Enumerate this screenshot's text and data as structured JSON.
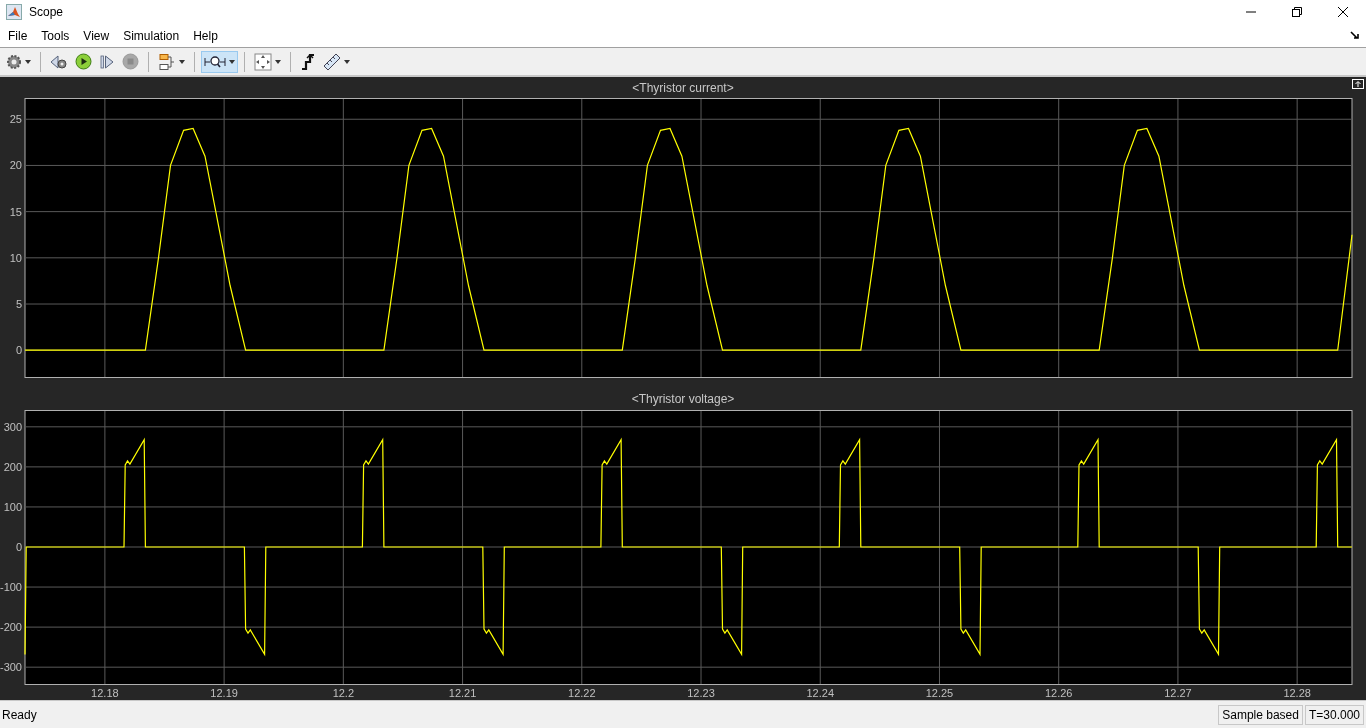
{
  "window": {
    "title": "Scope"
  },
  "menu": [
    "File",
    "Tools",
    "View",
    "Simulation",
    "Help"
  ],
  "toolbar": [
    {
      "kind": "gear",
      "dropdown": true,
      "selected": false
    },
    {
      "kind": "separator"
    },
    {
      "kind": "step-back",
      "dropdown": false,
      "selected": false
    },
    {
      "kind": "run",
      "dropdown": false,
      "selected": false
    },
    {
      "kind": "step-forward",
      "dropdown": false,
      "selected": false
    },
    {
      "kind": "stop",
      "dropdown": false,
      "selected": false
    },
    {
      "kind": "separator"
    },
    {
      "kind": "highlight",
      "dropdown": true,
      "selected": false
    },
    {
      "kind": "separator"
    },
    {
      "kind": "zoom",
      "dropdown": true,
      "selected": true
    },
    {
      "kind": "separator"
    },
    {
      "kind": "fit",
      "dropdown": true,
      "selected": false
    },
    {
      "kind": "separator"
    },
    {
      "kind": "triggers",
      "dropdown": false,
      "selected": false
    },
    {
      "kind": "measure",
      "dropdown": true,
      "selected": false
    }
  ],
  "plots": [
    {
      "chart_data": {
        "type": "line",
        "title": "<Thyristor current>",
        "grid": true,
        "xlim": [
          12.1733,
          12.2846
        ],
        "ylim": [
          -2.9,
          27.3
        ],
        "yticks": [
          0,
          5,
          10,
          15,
          20,
          25
        ],
        "x": [
          12.1733,
          12.1834,
          12.1845,
          12.1855,
          12.1866,
          12.1874,
          12.1884,
          12.1893,
          12.1905,
          12.1918,
          12.2034,
          12.2045,
          12.2055,
          12.2066,
          12.2074,
          12.2084,
          12.2093,
          12.2105,
          12.2118,
          12.2234,
          12.2245,
          12.2255,
          12.2266,
          12.2274,
          12.2284,
          12.2293,
          12.2305,
          12.2318,
          12.2434,
          12.2445,
          12.2455,
          12.2466,
          12.2474,
          12.2484,
          12.2493,
          12.2505,
          12.2518,
          12.2634,
          12.2645,
          12.2655,
          12.2666,
          12.2674,
          12.2684,
          12.2693,
          12.2705,
          12.2718,
          12.2834,
          12.2846
        ],
        "series": [
          {
            "color": "#ffff00",
            "values": [
              0,
              0,
              10,
              20,
              23.8,
              24,
              21,
              15,
              7,
              0,
              0,
              10,
              20,
              23.8,
              24,
              21,
              15,
              7,
              0,
              0,
              10,
              20,
              23.8,
              24,
              21,
              15,
              7,
              0,
              0,
              10,
              20,
              23.8,
              24,
              21,
              15,
              7,
              0,
              0,
              10,
              20,
              23.8,
              24,
              21,
              15,
              7,
              0,
              0,
              12.5
            ]
          }
        ]
      }
    },
    {
      "chart_data": {
        "type": "line",
        "title": "<Thyristor voltage>",
        "grid": true,
        "xlim": [
          12.1733,
          12.2846
        ],
        "ylim": [
          -342,
          342
        ],
        "xticks": [
          12.18,
          12.19,
          12.2,
          12.21,
          12.22,
          12.23,
          12.24,
          12.25,
          12.26,
          12.27,
          12.28
        ],
        "yticks": [
          -300,
          -200,
          -100,
          0,
          100,
          200,
          300
        ],
        "x": [
          12.1733,
          12.1734,
          12.1816,
          12.1817,
          12.1819,
          12.1821,
          12.1833,
          12.1834,
          12.1917,
          12.1918,
          12.192,
          12.1922,
          12.1934,
          12.1935,
          12.2016,
          12.2017,
          12.2019,
          12.2021,
          12.2033,
          12.2034,
          12.2117,
          12.2118,
          12.212,
          12.2122,
          12.2134,
          12.2135,
          12.2216,
          12.2217,
          12.2219,
          12.2221,
          12.2233,
          12.2234,
          12.2317,
          12.2318,
          12.232,
          12.2322,
          12.2334,
          12.2335,
          12.2416,
          12.2417,
          12.2419,
          12.2421,
          12.2433,
          12.2434,
          12.2517,
          12.2518,
          12.252,
          12.2522,
          12.2534,
          12.2535,
          12.2616,
          12.2617,
          12.2619,
          12.2621,
          12.2633,
          12.2634,
          12.2717,
          12.2718,
          12.272,
          12.2722,
          12.2734,
          12.2735,
          12.2816,
          12.2817,
          12.2819,
          12.2821,
          12.2833,
          12.2834,
          12.2846
        ],
        "series": [
          {
            "color": "#ffff00",
            "values": [
              -268,
              0,
              0,
              205,
              215,
              207,
              268,
              0,
              0,
              -205,
              -215,
              -207,
              -268,
              0,
              0,
              205,
              215,
              207,
              268,
              0,
              0,
              -205,
              -215,
              -207,
              -268,
              0,
              0,
              205,
              215,
              207,
              268,
              0,
              0,
              -205,
              -215,
              -207,
              -268,
              0,
              0,
              205,
              215,
              207,
              268,
              0,
              0,
              -205,
              -215,
              -207,
              -268,
              0,
              0,
              205,
              215,
              207,
              268,
              0,
              0,
              -205,
              -215,
              -207,
              -268,
              0,
              0,
              205,
              215,
              207,
              268,
              0,
              0
            ]
          }
        ]
      }
    }
  ],
  "status_bar": {
    "text": "Ready",
    "fields": [
      "Sample based",
      "T=30.000"
    ]
  }
}
